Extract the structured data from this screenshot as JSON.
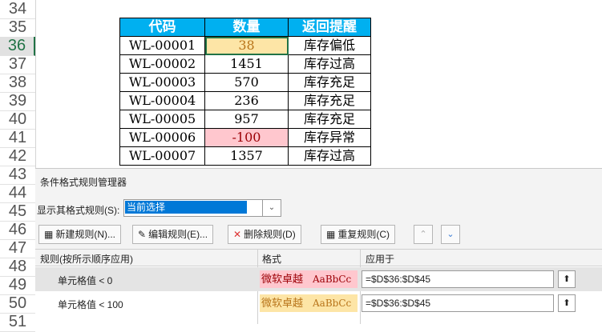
{
  "row_numbers": [
    "34",
    "35",
    "36",
    "37",
    "38",
    "39",
    "40",
    "41",
    "42",
    "43",
    "44",
    "45",
    "46",
    "47",
    "48",
    "49",
    "50",
    "51"
  ],
  "active_row": "36",
  "sheet": {
    "headers": [
      "代码",
      "数量",
      "返回提醒"
    ],
    "rows": [
      {
        "code": "WL-00001",
        "qty": "38",
        "note": "库存偏低",
        "style": "orange"
      },
      {
        "code": "WL-00002",
        "qty": "1451",
        "note": "库存过高",
        "style": ""
      },
      {
        "code": "WL-00003",
        "qty": "570",
        "note": "库存充足",
        "style": ""
      },
      {
        "code": "WL-00004",
        "qty": "236",
        "note": "库存充足",
        "style": ""
      },
      {
        "code": "WL-00005",
        "qty": "957",
        "note": "库存充足",
        "style": ""
      },
      {
        "code": "WL-00006",
        "qty": "-100",
        "note": "库存异常",
        "style": "red"
      },
      {
        "code": "WL-00007",
        "qty": "1357",
        "note": "库存过高",
        "style": ""
      }
    ]
  },
  "dialog": {
    "title": "条件格式规则管理器",
    "show_label": "显示其格式规则(S):",
    "show_value": "当前选择",
    "buttons": {
      "new_rule": "新建规则(N)...",
      "edit_rule": "编辑规则(E)...",
      "delete_rule": "删除规则(D)",
      "duplicate_rule": "重复规则(C)"
    },
    "columns": {
      "rule": "规则(按所示顺序应用)",
      "format": "格式",
      "applies_to": "应用于"
    },
    "rules": [
      {
        "name": "单元格值 < 0",
        "preview_cn": "微软卓越",
        "preview_en": "AaBbCc",
        "applies": "=$D$36:$D$45",
        "style": "red"
      },
      {
        "name": "单元格值 < 100",
        "preview_cn": "微软卓越",
        "preview_en": "AaBbCc",
        "applies": "=$D$36:$D$45",
        "style": "orange"
      }
    ]
  },
  "colors": {
    "header_bg": "#00b0f0",
    "selection": "#0078d7",
    "red_fill": "#ffc7ce",
    "red_text": "#9c0006",
    "orange_fill": "#fde5a6"
  }
}
